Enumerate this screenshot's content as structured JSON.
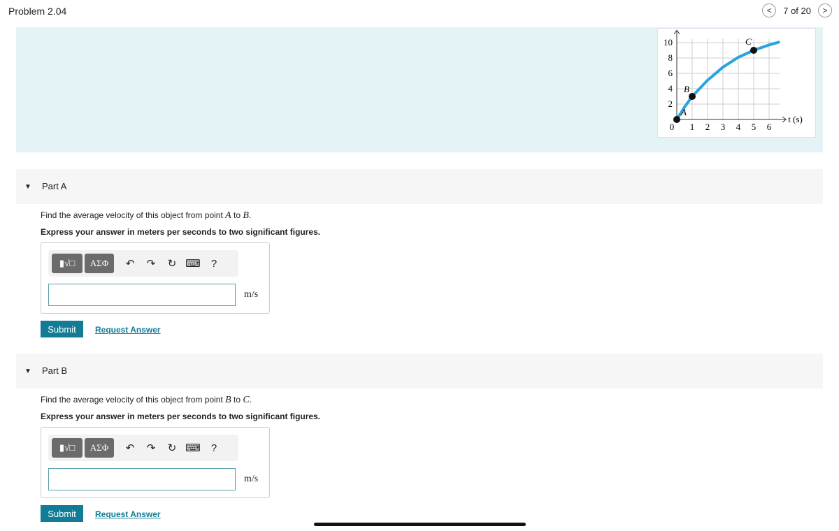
{
  "header": {
    "title": "Problem 2.04",
    "counter": "7 of 20",
    "prev_icon": "chevron-left-icon",
    "next_icon": "chevron-right-icon"
  },
  "chart_data": {
    "type": "line",
    "xlabel": "t (s)",
    "ylabel": "",
    "xlim": [
      0,
      6.8
    ],
    "ylim": [
      0,
      10.5
    ],
    "x_ticks": [
      "0",
      "1",
      "2",
      "3",
      "4",
      "5",
      "6"
    ],
    "y_ticks": [
      "2",
      "4",
      "6",
      "8",
      "10"
    ],
    "grid": true,
    "curve": {
      "color": "#2aa3e0",
      "x": [
        0,
        0.5,
        1,
        2,
        3,
        4,
        5,
        6,
        6.7
      ],
      "y": [
        0,
        1.6,
        3,
        5.1,
        6.8,
        8.1,
        9,
        9.7,
        10.1
      ]
    },
    "points": [
      {
        "label": "A",
        "x": 0,
        "y": 0
      },
      {
        "label": "B",
        "x": 1,
        "y": 3
      },
      {
        "label": "C",
        "x": 5,
        "y": 9
      }
    ]
  },
  "parts": [
    {
      "label": "Part A",
      "question_pre": "Find the average velocity of this object from point ",
      "p1": "A",
      "mid": " to ",
      "p2": "B",
      "end": ".",
      "instruction": "Express your answer in meters per seconds to two significant figures.",
      "unit": "m/s",
      "value": "",
      "submit": "Submit",
      "request": "Request Answer"
    },
    {
      "label": "Part B",
      "question_pre": "Find the average velocity of this object from point ",
      "p1": "B",
      "mid": " to ",
      "p2": "C",
      "end": ".",
      "instruction": "Express your answer in meters per seconds to two significant figures.",
      "unit": "m/s",
      "value": "",
      "submit": "Submit",
      "request": "Request Answer"
    }
  ],
  "toolbar": {
    "templates": "▮√□",
    "greek": "ΑΣΦ",
    "undo": "↶",
    "redo": "↷",
    "reset": "↻",
    "keyboard": "⌨",
    "help": "?"
  }
}
